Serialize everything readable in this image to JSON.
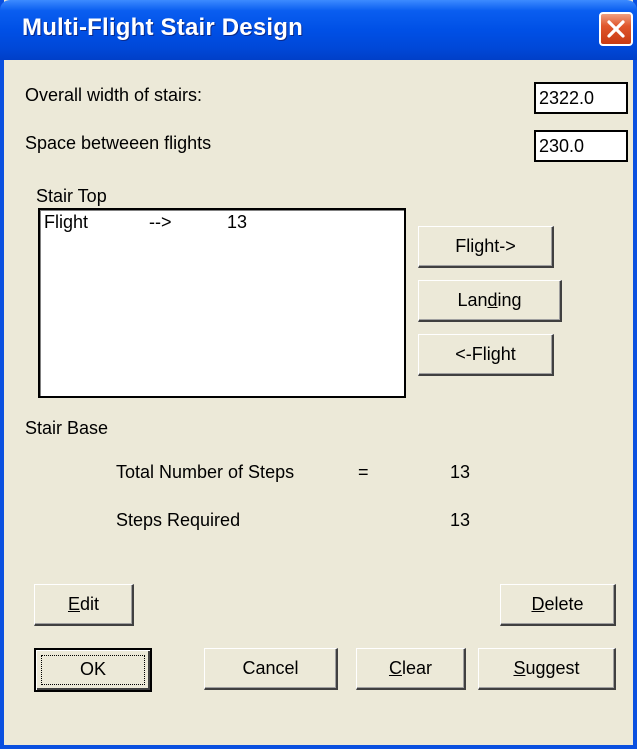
{
  "window": {
    "title": "Multi-Flight Stair Design"
  },
  "fields": {
    "overall_width_label": "Overall width of stairs:",
    "overall_width_value": "2322.0",
    "space_between_label": "Space betweeen flights",
    "space_between_value": "230.0"
  },
  "stair_top": {
    "label": "Stair Top",
    "rows": [
      {
        "name": "Flight",
        "arrow": "-->",
        "value": "13"
      }
    ]
  },
  "side_buttons": {
    "flight_right": "Flight->",
    "landing_pre": "Lan",
    "landing_u": "d",
    "landing_post": "ing",
    "flight_left": "<-Flight"
  },
  "stair_base": {
    "label": "Stair Base",
    "total_steps_label": "Total Number of Steps",
    "total_steps_eq": "=",
    "total_steps_value": "13",
    "steps_required_label": "Steps Required",
    "steps_required_value": "13"
  },
  "buttons": {
    "edit_u": "E",
    "edit_rest": "dit",
    "delete_u": "D",
    "delete_rest": "elete",
    "ok": "OK",
    "cancel": "Cancel",
    "clear_u": "C",
    "clear_rest": "lear",
    "suggest_u": "S",
    "suggest_rest": "uggest"
  },
  "colors": {
    "titlebar": "#0050e6",
    "dialog_bg": "#ece9d8",
    "close_button": "#e0562c"
  }
}
